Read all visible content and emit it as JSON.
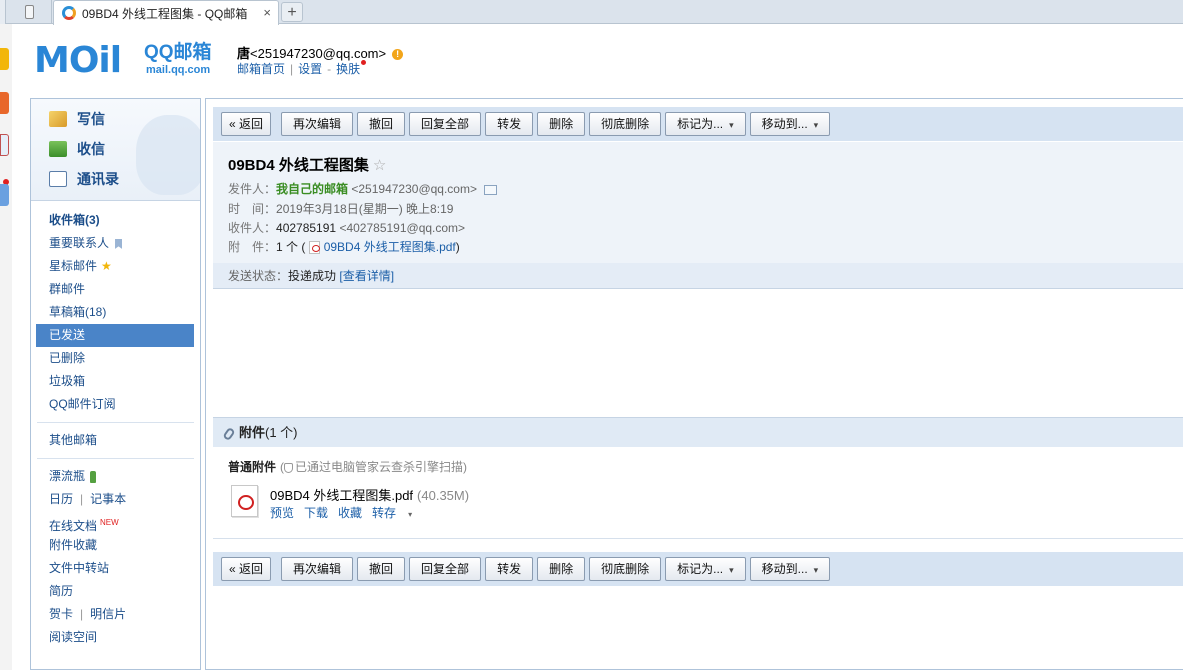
{
  "browser": {
    "tab_title": "09BD4 外线工程图集 - QQ邮箱",
    "tab_close": "×",
    "new_tab": "+"
  },
  "header": {
    "logo_text": "MOil",
    "logo_brand": "QQ邮箱",
    "logo_url": "mail.qq.com",
    "user_name": "唐",
    "user_email": "<251947230@qq.com>",
    "warn": "!",
    "links": [
      "邮箱首页",
      "设置",
      "换肤"
    ],
    "link_sep_pipe": "|",
    "link_sep_dash": "-"
  },
  "quick_actions": [
    {
      "label": "写信",
      "icon": "compose-icon"
    },
    {
      "label": "收信",
      "icon": "receive-icon"
    },
    {
      "label": "通讯录",
      "icon": "contacts-icon"
    }
  ],
  "folders": {
    "inbox": "收件箱(3)",
    "vip": "重要联系人",
    "starred": "星标邮件",
    "group": "群邮件",
    "drafts": "草稿箱(18)",
    "sent": "已发送",
    "deleted": "已删除",
    "spam": "垃圾箱",
    "subscriptions": "QQ邮件订阅",
    "other": "其他邮箱",
    "drift_bottle": "漂流瓶",
    "calendar": "日历",
    "notes": "记事本",
    "online_docs": "在线文档",
    "online_docs_badge": "NEW",
    "attachments": "附件收藏",
    "file_transfer": "文件中转站",
    "resume": "简历",
    "cards": "贺卡",
    "postcards": "明信片",
    "reading": "阅读空间",
    "pipe": "|"
  },
  "toolbar": {
    "back": "« 返回",
    "edit_again": "再次编辑",
    "recall": "撤回",
    "reply_all": "回复全部",
    "forward": "转发",
    "delete": "删除",
    "delete_forever": "彻底删除",
    "mark_as": "标记为...",
    "move_to": "移动到...",
    "caret": "▾"
  },
  "mail": {
    "subject": "09BD4 外线工程图集",
    "star": "☆",
    "from_label": "发件人：",
    "from_name": "我自己的邮箱",
    "from_email": "<251947230@qq.com>",
    "time_label": "时　间：",
    "time_value": "2019年3月18日(星期一) 晚上8:19",
    "to_label": "收件人：",
    "to_name": "402785191",
    "to_email": "<402785191@qq.com>",
    "att_label": "附　件：",
    "att_count": "1 个 (",
    "att_file": "09BD4 外线工程图集.pdf",
    "att_close": ")",
    "status_label": "发送状态：",
    "status_value": "投递成功",
    "status_link": "[查看详情]"
  },
  "attachments": {
    "header_bold": "附件",
    "header_count": "(1 个)",
    "kind": "普通附件",
    "scan_note": "已通过电脑管家云查杀引擎扫描)",
    "scan_open": "(",
    "file_name": "09BD4 外线工程图集.pdf",
    "file_size": "(40.35M)",
    "actions": [
      "预览",
      "下载",
      "收藏",
      "转存"
    ]
  }
}
